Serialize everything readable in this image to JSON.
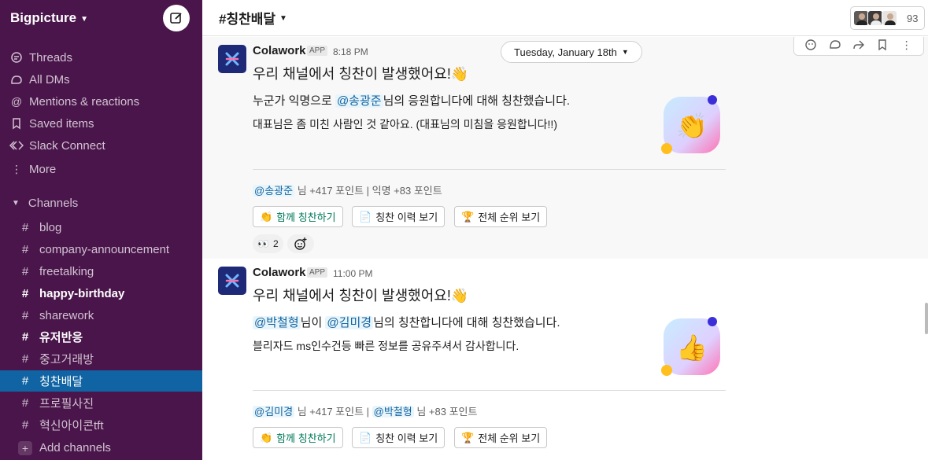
{
  "workspace": {
    "name": "Bigpicture"
  },
  "sidebar": {
    "nav": [
      {
        "label": "Threads",
        "icon": "threads-icon"
      },
      {
        "label": "All DMs",
        "icon": "dms-icon"
      },
      {
        "label": "Mentions & reactions",
        "icon": "mention-icon"
      },
      {
        "label": "Saved items",
        "icon": "bookmark-icon"
      },
      {
        "label": "Slack Connect",
        "icon": "connect-icon"
      },
      {
        "label": "More",
        "icon": "more-icon"
      }
    ],
    "channels_label": "Channels",
    "channels": [
      {
        "name": "blog",
        "bold": false,
        "active": false
      },
      {
        "name": "company-announcement",
        "bold": false,
        "active": false
      },
      {
        "name": "freetalking",
        "bold": false,
        "active": false
      },
      {
        "name": "happy-birthday",
        "bold": true,
        "active": false
      },
      {
        "name": "sharework",
        "bold": false,
        "active": false
      },
      {
        "name": "유저반응",
        "bold": true,
        "active": false
      },
      {
        "name": "중고거래방",
        "bold": false,
        "active": false
      },
      {
        "name": "칭찬배달",
        "bold": false,
        "active": true
      },
      {
        "name": "프로필사진",
        "bold": false,
        "active": false
      },
      {
        "name": "혁신아이콘tft",
        "bold": false,
        "active": false
      }
    ],
    "add_channels": "Add channels"
  },
  "header": {
    "hash": "#",
    "channel": "칭찬배달",
    "member_count": "93"
  },
  "date_divider": "Tuesday, January 18th",
  "messages": [
    {
      "sender": "Colawork",
      "badge": "APP",
      "time": "8:18 PM",
      "headline": "우리 채널에서 칭찬이 발생했어요!👋",
      "line1_pre": "누군가 익명으로 ",
      "line1_mention": "@송광준",
      "line1_post": "님의 응원합니다에 대해 칭찬했습니다.",
      "line2": "대표님은 좀 미친 사람인 것 같아요. (대표님의 미침을 응원합니다!!)",
      "points_mention": "@송광준",
      "points_rest": " 님 +417 포인트 | 익명 +83 포인트",
      "graphic_emoji": "👏",
      "reaction": {
        "emoji": "👀",
        "count": "2"
      }
    },
    {
      "sender": "Colawork",
      "badge": "APP",
      "time": "11:00 PM",
      "headline": "우리 채널에서 칭찬이 발생했어요!👋",
      "line1_mention1": "@박철형",
      "line1_mid": "님이 ",
      "line1_mention2": "@김미경",
      "line1_post": "님의 칭찬합니다에 대해 칭찬했습니다.",
      "line2": "블리자드 ms인수건등 빠른 정보를 공유주셔서 감사합니다.",
      "points_mention1": "@김미경",
      "points_mid": " 님 +417 포인트 | ",
      "points_mention2": "@박철형",
      "points_rest": " 님 +83 포인트",
      "graphic_emoji": "👍"
    }
  ],
  "buttons": {
    "praise_together": "함께 칭찬하기",
    "praise_together_icon": "👏",
    "history": "칭찬 이력 보기",
    "history_icon": "📄",
    "ranking": "전체 순위 보기",
    "ranking_icon": "🏆"
  },
  "colors": {
    "sidebar": "#4a154b",
    "active": "#1164a3",
    "mention": "#1264a3",
    "green": "#007a5a"
  }
}
